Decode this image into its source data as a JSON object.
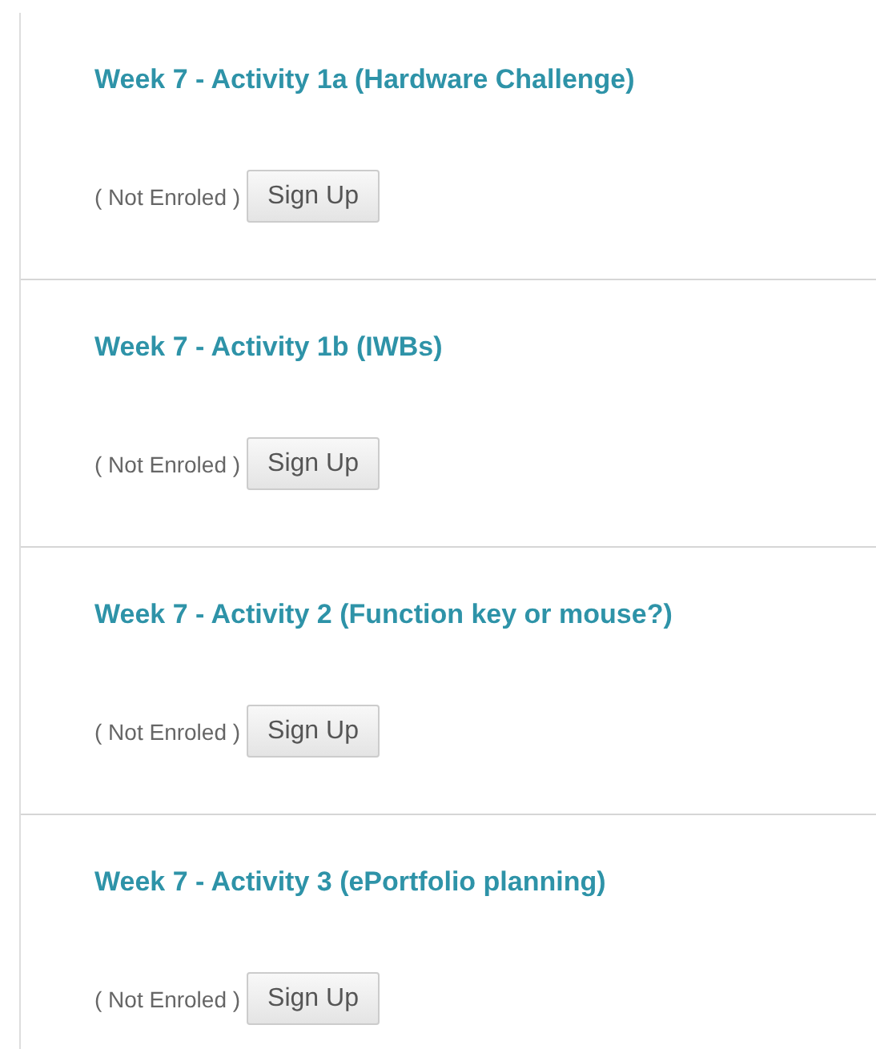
{
  "activities": [
    {
      "title": "Week 7 - Activity 1a (Hardware Challenge)",
      "status": "( Not Enroled )",
      "button": "Sign Up"
    },
    {
      "title": "Week 7 - Activity 1b (IWBs)",
      "status": "( Not Enroled )",
      "button": "Sign Up"
    },
    {
      "title": "Week 7 - Activity 2 (Function key or mouse?)",
      "status": "( Not Enroled )",
      "button": "Sign Up"
    },
    {
      "title": "Week 7 - Activity 3 (ePortfolio planning)",
      "status": "( Not Enroled )",
      "button": "Sign Up"
    }
  ]
}
